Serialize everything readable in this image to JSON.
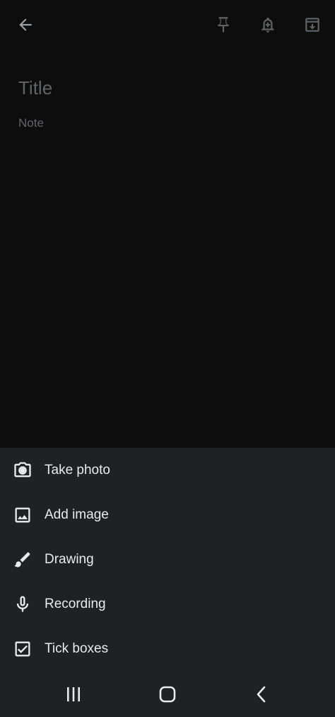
{
  "top_bar": {
    "back_icon": "arrow-back-icon",
    "pin_icon": "pin-icon",
    "reminder_icon": "add-reminder-icon",
    "archive_icon": "archive-icon"
  },
  "note": {
    "title_placeholder": "Title",
    "note_placeholder": "Note"
  },
  "sheet": {
    "items": [
      {
        "label": "Take photo",
        "icon": "camera-icon"
      },
      {
        "label": "Add image",
        "icon": "image-icon"
      },
      {
        "label": "Drawing",
        "icon": "brush-icon"
      },
      {
        "label": "Recording",
        "icon": "microphone-icon"
      },
      {
        "label": "Tick boxes",
        "icon": "checkbox-icon"
      }
    ]
  },
  "nav_bar": {
    "recent_icon": "recent-apps-icon",
    "home_icon": "home-icon",
    "back_icon": "nav-back-icon"
  },
  "colors": {
    "background": "#0d0d0d",
    "sheet": "#202124",
    "text": "#e8eaed",
    "placeholder": "#5f6368"
  }
}
